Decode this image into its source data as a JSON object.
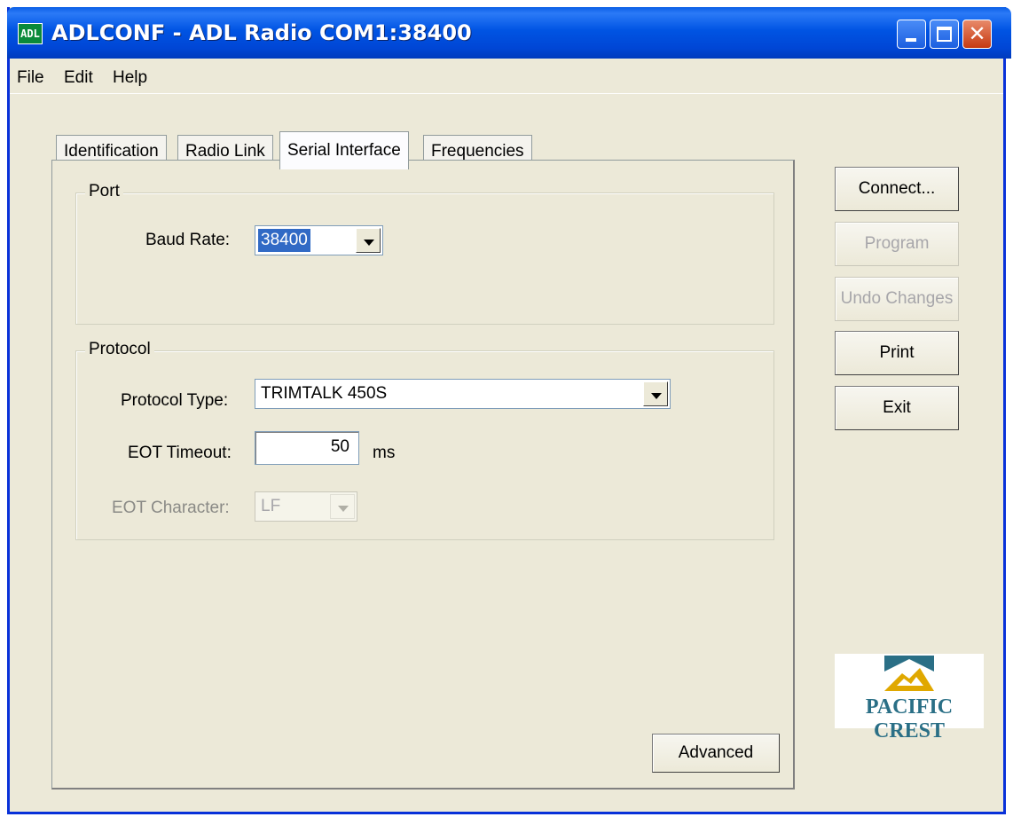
{
  "window": {
    "icon_text": "ADL",
    "title": "ADLCONF - ADL Radio COM1:38400",
    "close_glyph": "✕"
  },
  "menu": {
    "items": [
      "File",
      "Edit",
      "Help"
    ]
  },
  "tabs": [
    {
      "label": "Identification",
      "active": false
    },
    {
      "label": "Radio Link",
      "active": false
    },
    {
      "label": "Serial Interface",
      "active": true
    },
    {
      "label": "Frequencies",
      "active": false
    }
  ],
  "port_group": {
    "title": "Port",
    "baud_rate_label": "Baud Rate:",
    "baud_rate_value": "38400"
  },
  "protocol_group": {
    "title": "Protocol",
    "protocol_type_label": "Protocol Type:",
    "protocol_type_value": "TRIMTALK 450S",
    "eot_timeout_label": "EOT Timeout:",
    "eot_timeout_value": "50",
    "eot_timeout_unit": "ms",
    "eot_character_label": "EOT Character:",
    "eot_character_value": "LF"
  },
  "buttons": {
    "connect": "Connect...",
    "program": "Program",
    "undo_changes": "Undo Changes",
    "print": "Print",
    "exit": "Exit",
    "advanced": "Advanced"
  },
  "logo": {
    "text": "PACIFIC CREST",
    "colors": {
      "teal": "#2a6f86",
      "gold": "#e0a800"
    }
  }
}
